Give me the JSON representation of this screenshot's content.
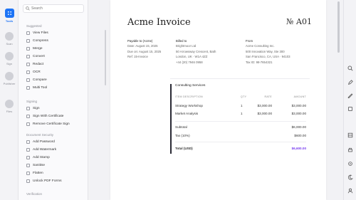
{
  "rail": {
    "items": [
      {
        "label": "Tools",
        "icon": "grid-icon",
        "active": true
      },
      {
        "label": "Scan",
        "icon": "scan-icon"
      },
      {
        "label": "Sign",
        "icon": "sign-icon"
      },
      {
        "label": "Publisher",
        "icon": "publisher-icon"
      },
      {
        "label": "Files",
        "icon": "files-icon"
      }
    ]
  },
  "sidebar": {
    "search_placeholder": "Search",
    "sections": [
      {
        "title": "Suggested",
        "items": [
          "View Files",
          "Compress",
          "Merge",
          "Convert",
          "Redact",
          "OCR",
          "Compare",
          "Multi Tool"
        ]
      },
      {
        "title": "Signing",
        "items": [
          "Sign",
          "Sign With Certificate",
          "Remove Certificate Sign"
        ]
      },
      {
        "title": "Document Security",
        "items": [
          "Add Password",
          "Add Watermark",
          "Add Stamp",
          "Sanitise",
          "Flatten",
          "Unlock PDF Forms"
        ]
      },
      {
        "title": "Verification",
        "items": []
      }
    ]
  },
  "invoice": {
    "title": "Acme Invoice",
    "number": "№ A01",
    "bill_from_header": "Payable to (Acme)",
    "dates": [
      "Date: August 15, 2025",
      "Due on: August 15, 2025",
      "Ref: 15-Invoice"
    ],
    "billed_to": {
      "header": "Billed to",
      "lines": [
        "Brightmoor Ltd",
        "50 Arrowsway Crescent, Bath",
        "London, UK · W1A 4ZZ",
        "+44 (20) 7946 0958"
      ]
    },
    "from": {
      "header": "From",
      "lines": [
        "Acme Consulting Inc.",
        "500 Innovation Way, Ste 300",
        "San Francisco, CA, USA · 94103",
        "Tax ID: 98-7654321"
      ]
    },
    "section_title": "Consulting Services",
    "columns": {
      "desc": "ITEM DESCRIPTION",
      "qty": "QTY",
      "rate": "RATE",
      "amount": "AMOUNT"
    },
    "rows": [
      {
        "desc": "Strategy Workshop",
        "qty": "1",
        "rate": "$3,000.00",
        "amount": "$3,000.00"
      },
      {
        "desc": "Market Analysis",
        "qty": "1",
        "rate": "$3,000.00",
        "amount": "$3,000.00"
      }
    ],
    "subtotal_label": "Subtotal",
    "subtotal": "$6,000.00",
    "tax_label": "Tax (10%)",
    "tax": "$600.00",
    "total_label": "Total (USD)",
    "total": "$6,600.00"
  },
  "colors": {
    "accent": "#1e74f5",
    "total": "#7a3ff0"
  },
  "right_rail_icons": [
    "search-icon",
    "pen-icon",
    "edit-icon",
    "crop-icon",
    "layers-icon",
    "print-icon",
    "settings-icon",
    "moon-icon",
    "account-icon"
  ],
  "top_right_icons": [
    "info-icon",
    "folder-icon",
    "bookmark-icon",
    "settings-icon"
  ]
}
